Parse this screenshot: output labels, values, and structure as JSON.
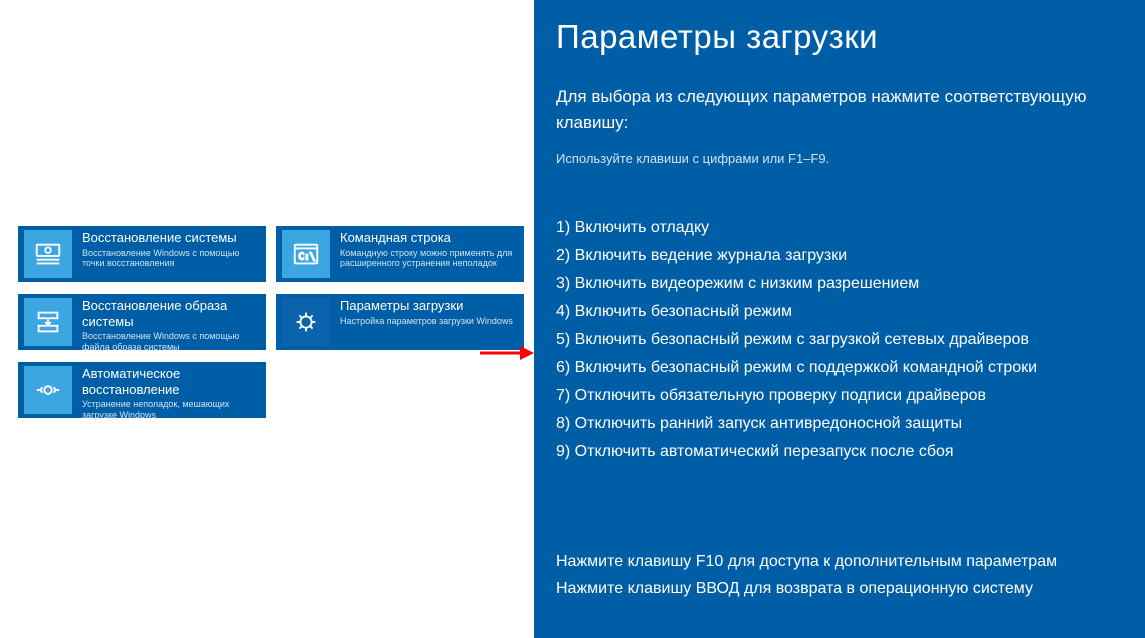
{
  "left": {
    "tiles": [
      {
        "title": "Восстановление системы",
        "desc": "Восстановление Windows с помощью точки восстановления"
      },
      {
        "title": "Командная строка",
        "desc": "Командную строку можно применять для расширенного устранения неполадок"
      },
      {
        "title": "Восстановление образа системы",
        "desc": "Восстановление Windows с помощью файла образа системы"
      },
      {
        "title": "Параметры загрузки",
        "desc": "Настройка параметров загрузки Windows"
      },
      {
        "title": "Автоматическое восстановление",
        "desc": "Устранение неполадок, мешающих загрузке Windows"
      }
    ]
  },
  "right": {
    "title": "Параметры загрузки",
    "subtitle": "Для выбора из следующих параметров нажмите соответствующую клавишу:",
    "hint": "Используйте клавиши с цифрами или F1–F9.",
    "options": [
      "1) Включить отладку",
      "2) Включить ведение журнала загрузки",
      "3) Включить видеорежим с низким разрешением",
      "4) Включить безопасный режим",
      "5) Включить безопасный режим с загрузкой сетевых драйверов",
      "6) Включить безопасный режим с поддержкой командной строки",
      "7) Отключить обязательную проверку подписи драйверов",
      "8) Отключить ранний запуск антивредоносной защиты",
      "9) Отключить автоматический перезапуск после сбоя"
    ],
    "footer1": "Нажмите клавишу F10 для доступа к дополнительным параметрам",
    "footer2": "Нажмите клавишу ВВОД для возврата в операционную систему"
  }
}
